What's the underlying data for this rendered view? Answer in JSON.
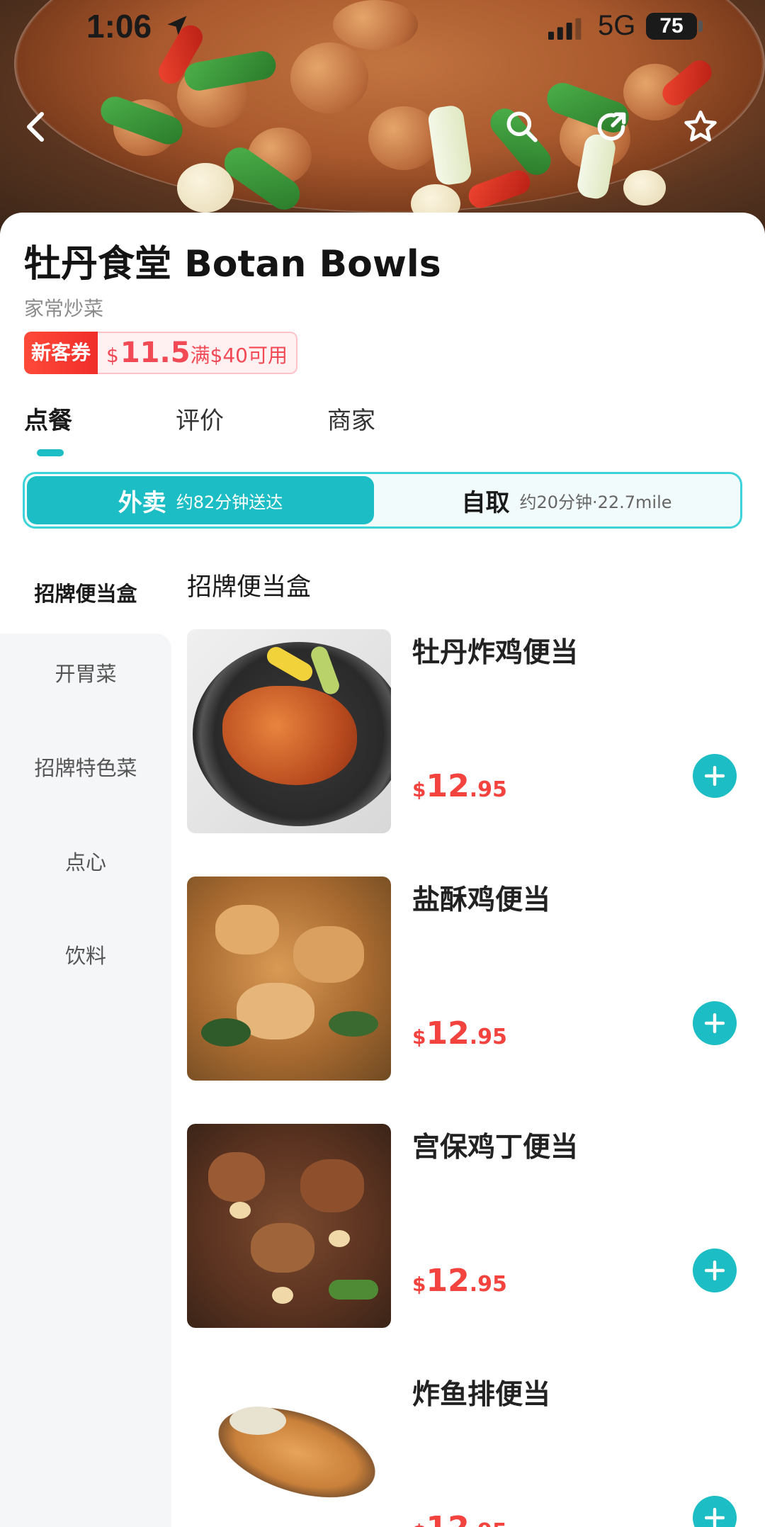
{
  "status_bar": {
    "time": "1:06",
    "network": "5G",
    "battery": "75"
  },
  "store": {
    "name": "牡丹食堂 Botan Bowls",
    "category": "家常炒菜",
    "coupon": {
      "tag": "新客券",
      "currency": "$",
      "amount": "11.5",
      "condition": "满$40可用"
    }
  },
  "tabs": [
    {
      "label": "点餐",
      "active": true
    },
    {
      "label": "评价",
      "active": false
    },
    {
      "label": "商家",
      "active": false
    }
  ],
  "delivery_modes": {
    "delivery": {
      "label": "外卖",
      "detail": "约82分钟送达",
      "selected": true
    },
    "pickup": {
      "label": "自取",
      "detail": "约20分钟·22.7mile",
      "selected": false
    }
  },
  "sidebar": {
    "items": [
      {
        "label": "招牌便当盒",
        "active": true
      },
      {
        "label": "开胃菜",
        "active": false
      },
      {
        "label": "招牌特色菜",
        "active": false
      },
      {
        "label": "点心",
        "active": false
      },
      {
        "label": "饮料",
        "active": false
      }
    ]
  },
  "menu": {
    "section_title": "招牌便当盒",
    "items": [
      {
        "name": "牡丹炸鸡便当",
        "currency": "$",
        "price_int": "12",
        "price_dec": ".95"
      },
      {
        "name": "盐酥鸡便当",
        "currency": "$",
        "price_int": "12",
        "price_dec": ".95"
      },
      {
        "name": "宫保鸡丁便当",
        "currency": "$",
        "price_int": "12",
        "price_dec": ".95"
      },
      {
        "name": "炸鱼排便当",
        "currency": "$",
        "price_int": "12",
        "price_dec": ".95"
      }
    ]
  },
  "icons": [
    "back-icon",
    "search-icon",
    "share-icon",
    "star-icon",
    "add-icon",
    "location-arrow-icon",
    "signal-icon"
  ],
  "colors": {
    "accent": "#1cbdc4",
    "price": "#f2433e",
    "coupon": "#f24a55"
  }
}
